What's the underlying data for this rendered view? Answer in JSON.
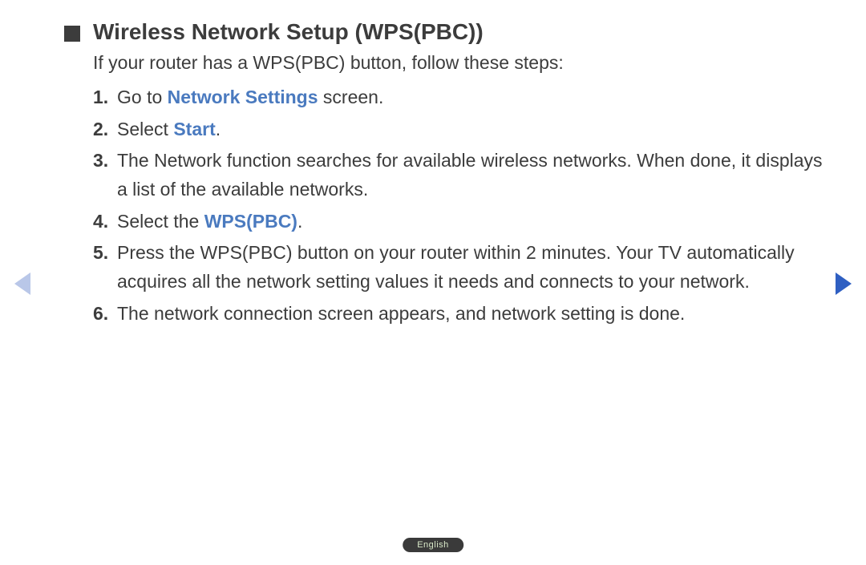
{
  "heading": "Wireless Network Setup (WPS(PBC))",
  "intro": "If your router has a WPS(PBC) button, follow these steps:",
  "steps": {
    "1": {
      "pre": "Go to ",
      "hl": "Network Settings",
      "post": " screen."
    },
    "2": {
      "pre": "Select ",
      "hl": "Start",
      "post": "."
    },
    "3": {
      "text": "The Network function searches for available wireless networks. When done, it displays a list of the available networks."
    },
    "4": {
      "pre": "Select the ",
      "hl": "WPS(PBC)",
      "post": "."
    },
    "5": {
      "text": "Press the WPS(PBC) button on your router within 2 minutes. Your TV automatically acquires all the network setting values it needs and connects to your network."
    },
    "6": {
      "text": "The network connection screen appears, and network setting is done."
    }
  },
  "language_label": "English",
  "colors": {
    "highlight": "#4a7abf",
    "text": "#3c3c3c",
    "nav_prev": "#b9c7e8",
    "nav_next": "#2f5fc2"
  }
}
